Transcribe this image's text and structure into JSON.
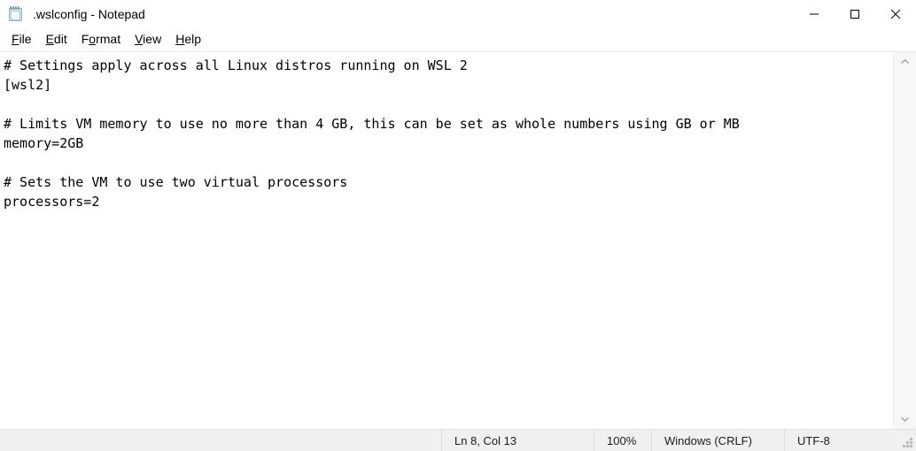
{
  "window": {
    "title": ".wslconfig - Notepad",
    "icon": "notepad-icon",
    "controls": {
      "minimize": "minimize-icon",
      "maximize": "maximize-icon",
      "close": "close-icon"
    }
  },
  "menu": {
    "items": [
      {
        "label": "File",
        "accel_before": "",
        "accel": "F",
        "accel_after": "ile"
      },
      {
        "label": "Edit",
        "accel_before": "",
        "accel": "E",
        "accel_after": "dit"
      },
      {
        "label": "Format",
        "accel_before": "F",
        "accel": "o",
        "accel_after": "rmat"
      },
      {
        "label": "View",
        "accel_before": "",
        "accel": "V",
        "accel_after": "iew"
      },
      {
        "label": "Help",
        "accel_before": "",
        "accel": "H",
        "accel_after": "elp"
      }
    ]
  },
  "editor": {
    "lines": [
      "# Settings apply across all Linux distros running on WSL 2",
      "[wsl2]",
      "",
      "# Limits VM memory to use no more than 4 GB, this can be set as whole numbers using GB or MB",
      "memory=2GB",
      "",
      "# Sets the VM to use two virtual processors",
      "processors=2"
    ]
  },
  "scrollbar": {
    "up_arrow": "chevron-up-icon",
    "down_arrow": "chevron-down-icon"
  },
  "status": {
    "cursor": "Ln 8, Col 13",
    "zoom": "100%",
    "line_ending": "Windows (CRLF)",
    "encoding": "UTF-8"
  },
  "colors": {
    "window_bg": "#ffffff",
    "status_bg": "#f0f0f0",
    "scrollbar_bg": "#f7f7f7",
    "text": "#000000",
    "icon_blue": "#cfe8f2"
  }
}
